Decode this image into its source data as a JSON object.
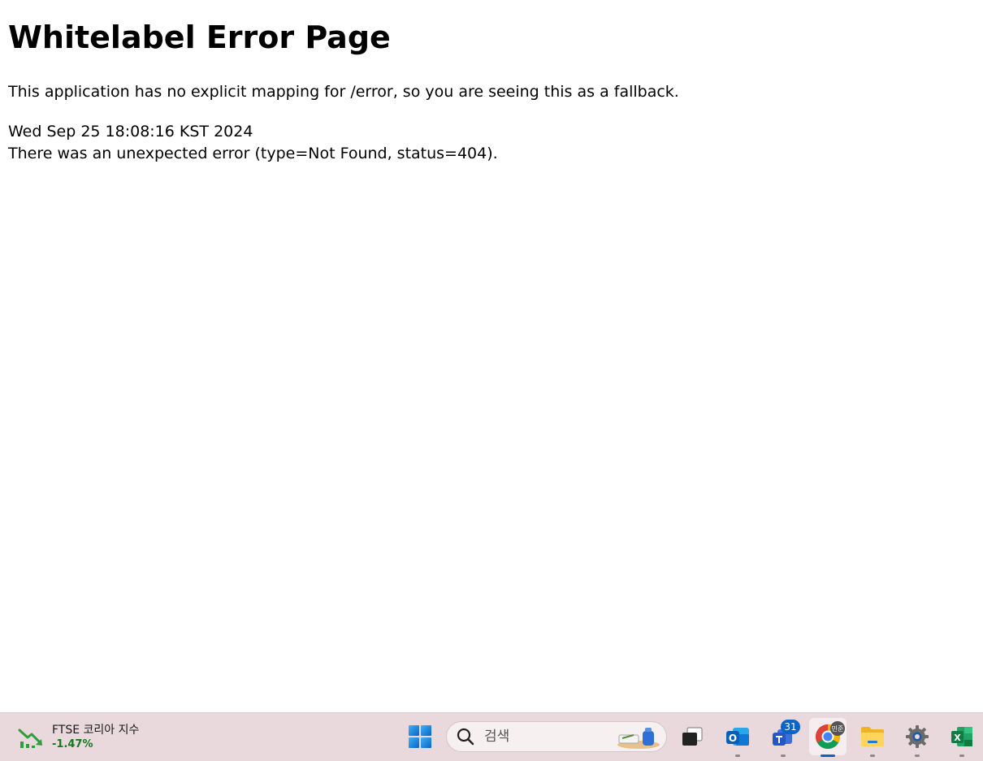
{
  "page": {
    "title": "Whitelabel Error Page",
    "message": "This application has no explicit mapping for /error, so you are seeing this as a fallback.",
    "timestamp": "Wed Sep 25 18:08:16 KST 2024",
    "error_detail": "There was an unexpected error (type=Not Found, status=404)."
  },
  "taskbar": {
    "widget": {
      "title": "FTSE 코리아 지수",
      "value": "-1.47%",
      "icon": "stock-down-icon",
      "value_color": "#137a1e"
    },
    "search": {
      "placeholder": "검색",
      "icon": "search-icon"
    },
    "apps": [
      {
        "name": "start-button",
        "icon": "windows-logo-icon"
      },
      {
        "name": "task-view",
        "icon": "task-view-icon"
      },
      {
        "name": "outlook",
        "icon": "outlook-icon"
      },
      {
        "name": "teams",
        "icon": "teams-icon",
        "badge": "31"
      },
      {
        "name": "chrome",
        "icon": "chrome-icon",
        "profile_badge": "민준"
      },
      {
        "name": "file-explorer",
        "icon": "folder-icon"
      },
      {
        "name": "settings",
        "icon": "gear-icon"
      },
      {
        "name": "excel",
        "icon": "excel-icon"
      }
    ],
    "colors": {
      "background": "#e9d8dc",
      "accent": "#0a64c8"
    }
  }
}
